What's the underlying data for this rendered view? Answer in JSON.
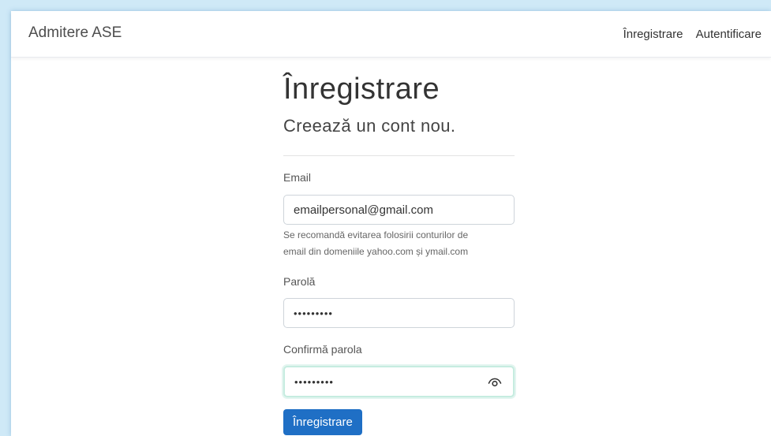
{
  "navbar": {
    "brand": "Admitere ASE",
    "links": [
      "Înregistrare",
      "Autentificare"
    ]
  },
  "form": {
    "title": "Înregistrare",
    "subtitle": "Creează un cont nou.",
    "email": {
      "label": "Email",
      "value": "emailpersonal@gmail.com",
      "hint_line1": "Se recomandă evitarea folosirii conturilor de",
      "hint_line2": "email din domeniile yahoo.com și ymail.com"
    },
    "password": {
      "label": "Parolă",
      "value": "•••••••••"
    },
    "confirm": {
      "label": "Confirmă parola",
      "value": "•••••••••",
      "icon": "eye-icon"
    },
    "submit_label": "Înregistrare"
  },
  "colors": {
    "background": "#cfe9f7",
    "primary_button": "#1f6fc5",
    "focus_border": "#c6ece0"
  }
}
